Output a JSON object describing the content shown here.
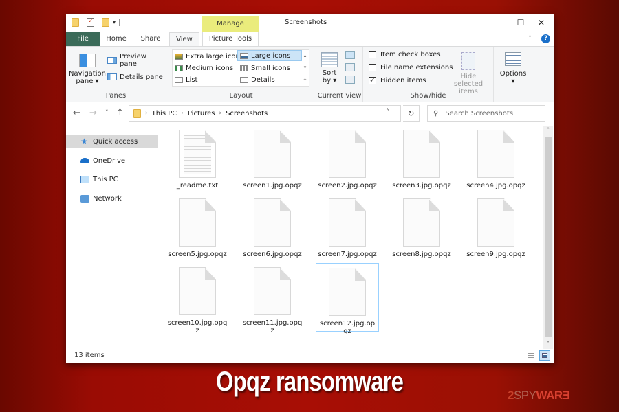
{
  "window": {
    "title": "Screenshots",
    "context_tab": "Manage",
    "controls": {
      "minimize": "–",
      "maximize": "☐",
      "close": "✕"
    }
  },
  "tabs": [
    {
      "label": "File"
    },
    {
      "label": "Home"
    },
    {
      "label": "Share"
    },
    {
      "label": "View",
      "active": true
    },
    {
      "label": "Picture Tools"
    }
  ],
  "ribbon": {
    "panes": {
      "label": "Panes",
      "navigation_pane": "Navigation pane",
      "preview_pane": "Preview pane",
      "details_pane": "Details pane"
    },
    "layout": {
      "label": "Layout",
      "options": [
        {
          "label": "Extra large icons"
        },
        {
          "label": "Large icons",
          "selected": true
        },
        {
          "label": "Medium icons"
        },
        {
          "label": "Small icons"
        },
        {
          "label": "List"
        },
        {
          "label": "Details"
        }
      ]
    },
    "current_view": {
      "label": "Current view",
      "sort_by": "Sort by"
    },
    "show_hide": {
      "label": "Show/hide",
      "item_check_boxes": {
        "label": "Item check boxes",
        "checked": false
      },
      "file_name_extensions": {
        "label": "File name extensions",
        "checked": false
      },
      "hidden_items": {
        "label": "Hidden items",
        "checked": true
      },
      "hide_selected": "Hide selected items"
    },
    "options": "Options"
  },
  "address": {
    "breadcrumb": [
      "This PC",
      "Pictures",
      "Screenshots"
    ],
    "search_placeholder": "Search Screenshots"
  },
  "nav_pane": {
    "items": [
      {
        "label": "Quick access",
        "icon": "star-icon",
        "selected": true
      },
      {
        "label": "OneDrive",
        "icon": "cloud-icon"
      },
      {
        "label": "This PC",
        "icon": "computer-icon"
      },
      {
        "label": "Network",
        "icon": "network-icon"
      }
    ]
  },
  "files": [
    {
      "name": "_readme.txt",
      "type": "text"
    },
    {
      "name": "screen1.jpg.opqz",
      "type": "blank"
    },
    {
      "name": "screen2.jpg.opqz",
      "type": "blank"
    },
    {
      "name": "screen3.jpg.opqz",
      "type": "blank"
    },
    {
      "name": "screen4.jpg.opqz",
      "type": "blank"
    },
    {
      "name": "screen5.jpg.opqz",
      "type": "blank"
    },
    {
      "name": "screen6.jpg.opqz",
      "type": "blank"
    },
    {
      "name": "screen7.jpg.opqz",
      "type": "blank"
    },
    {
      "name": "screen8.jpg.opqz",
      "type": "blank"
    },
    {
      "name": "screen9.jpg.opqz",
      "type": "blank"
    },
    {
      "name": "screen10.jpg.opqz",
      "type": "blank"
    },
    {
      "name": "screen11.jpg.opqz",
      "type": "blank"
    },
    {
      "name": "screen12.jpg.opqz",
      "type": "blank",
      "selected": true
    }
  ],
  "status": {
    "item_count": "13 items"
  },
  "caption": "Opqz ransomware",
  "brand": {
    "part1": "2",
    "part2": "SPY",
    "part3": "WAR",
    "part4": "Ǝ"
  },
  "colors": {
    "file_tab": "#3b6b59",
    "manage_tab": "#eaec7c",
    "selection": "#cce4f7",
    "background_red": "#a80e05"
  }
}
